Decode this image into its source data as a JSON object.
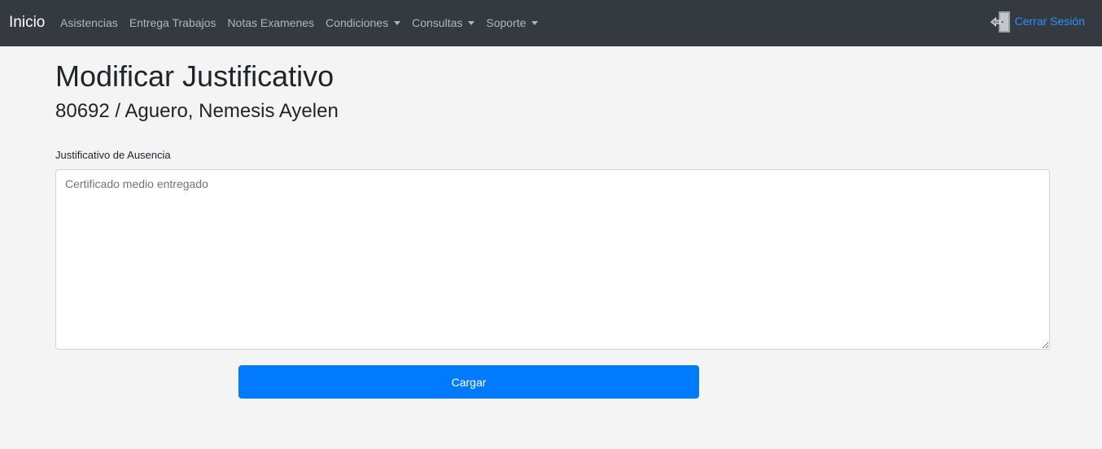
{
  "navbar": {
    "brand": "Inicio",
    "items": [
      {
        "label": "Asistencias",
        "dropdown": false
      },
      {
        "label": "Entrega Trabajos",
        "dropdown": false
      },
      {
        "label": "Notas Examenes",
        "dropdown": false
      },
      {
        "label": "Condiciones",
        "dropdown": true
      },
      {
        "label": "Consultas",
        "dropdown": true
      },
      {
        "label": "Soporte",
        "dropdown": true
      }
    ],
    "logout_label": "Cerrar Sesión",
    "logout_icon": "door-exit-icon"
  },
  "page": {
    "title": "Modificar Justificativo",
    "subtitle": "80692 / Aguero, Nemesis Ayelen"
  },
  "form": {
    "label": "Justificativo de Ausencia",
    "placeholder": "Certificado medio entregado",
    "value": "",
    "submit_label": "Cargar"
  },
  "colors": {
    "navbar_bg": "#343a40",
    "page_bg": "#f4f4f4",
    "primary": "#007bff",
    "link": "#2f8fff"
  }
}
